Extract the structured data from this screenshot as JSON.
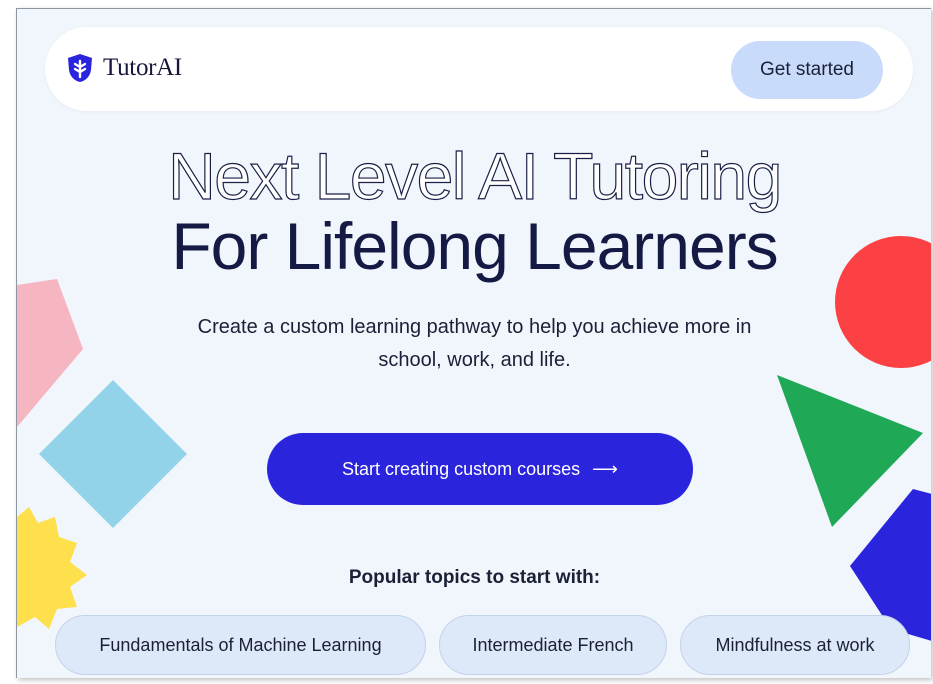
{
  "brand": {
    "name": "TutorAI",
    "color": "#2a24dd"
  },
  "nav": {
    "get_started_label": "Get started"
  },
  "hero": {
    "line1": "Next Level AI Tutoring",
    "line2": "For Lifelong Learners",
    "subtitle": "Create a custom learning pathway to help you achieve more in school, work, and life."
  },
  "cta": {
    "label": "Start creating custom courses",
    "icon": "arrow-right-icon",
    "arrow_glyph": "⟶"
  },
  "topics": {
    "heading": "Popular topics to start with:",
    "items": [
      "Fundamentals of Machine Learning",
      "Intermediate French",
      "Mindfulness at work"
    ]
  },
  "decorations": {
    "pink_square": "#f5b6c2",
    "blue_diamond": "#93d3ea",
    "yellow_star": "#fde04b",
    "red_circle": "#fb4143",
    "green_triangle": "#1fa856",
    "blue_pentagon": "#2a24dd"
  }
}
